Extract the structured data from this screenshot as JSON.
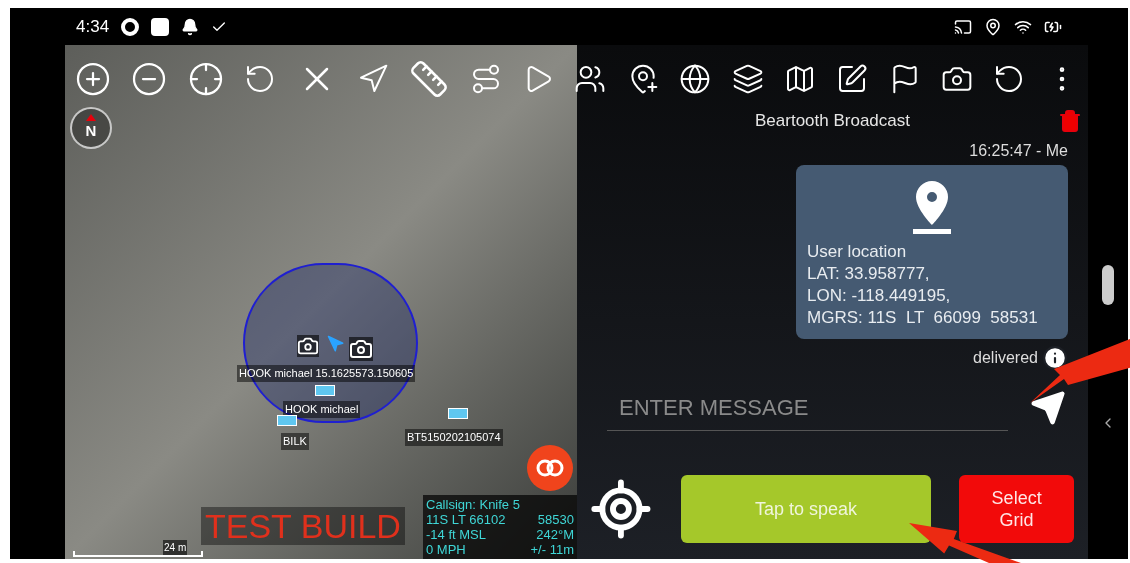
{
  "status_bar": {
    "time": "4:34"
  },
  "map": {
    "compass": "N",
    "labels": [
      {
        "text": "HOOK michael 15.1625573.150605",
        "kind": "marker"
      },
      {
        "text": "HOOK michael",
        "kind": "marker"
      },
      {
        "text": "BILK",
        "kind": "marker"
      },
      {
        "text": "BT5150202105074",
        "kind": "marker"
      }
    ],
    "watermark": "TEST BUILD",
    "scale": "24 m",
    "info": {
      "callsign": "Callsign: Knife 5",
      "rows": [
        [
          "11S LT 66102",
          "58530"
        ],
        [
          "-14 ft MSL",
          "242°M"
        ],
        [
          "0 MPH",
          "+/- 11m"
        ]
      ]
    }
  },
  "chat": {
    "title": "Beartooth Broadcast",
    "timestamp": "16:25:47 - Me",
    "message": [
      "User location",
      "LAT: 33.958777,",
      "LON: -118.449195,",
      "MGRS: 11S  LT  66099  58531"
    ],
    "status": "delivered",
    "input": {
      "placeholder": "ENTER MESSAGE"
    },
    "buttons": [
      {
        "label": "Tap to speak",
        "kind": "speak"
      },
      {
        "label": "Select Grid",
        "kind": "grid"
      }
    ]
  }
}
